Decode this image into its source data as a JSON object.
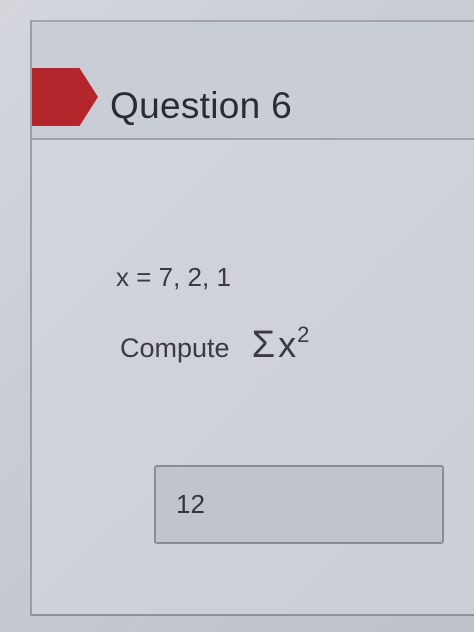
{
  "question": {
    "title": "Question 6",
    "dataset": "x = 7, 2, 1",
    "prompt_label": "Compute",
    "expression": {
      "sigma": "Σ",
      "variable": "x",
      "exponent": "2"
    }
  },
  "answer": {
    "value": "12"
  },
  "colors": {
    "flag": "#b3262b",
    "background": "#c9cbd3",
    "text": "#3a3b42"
  }
}
